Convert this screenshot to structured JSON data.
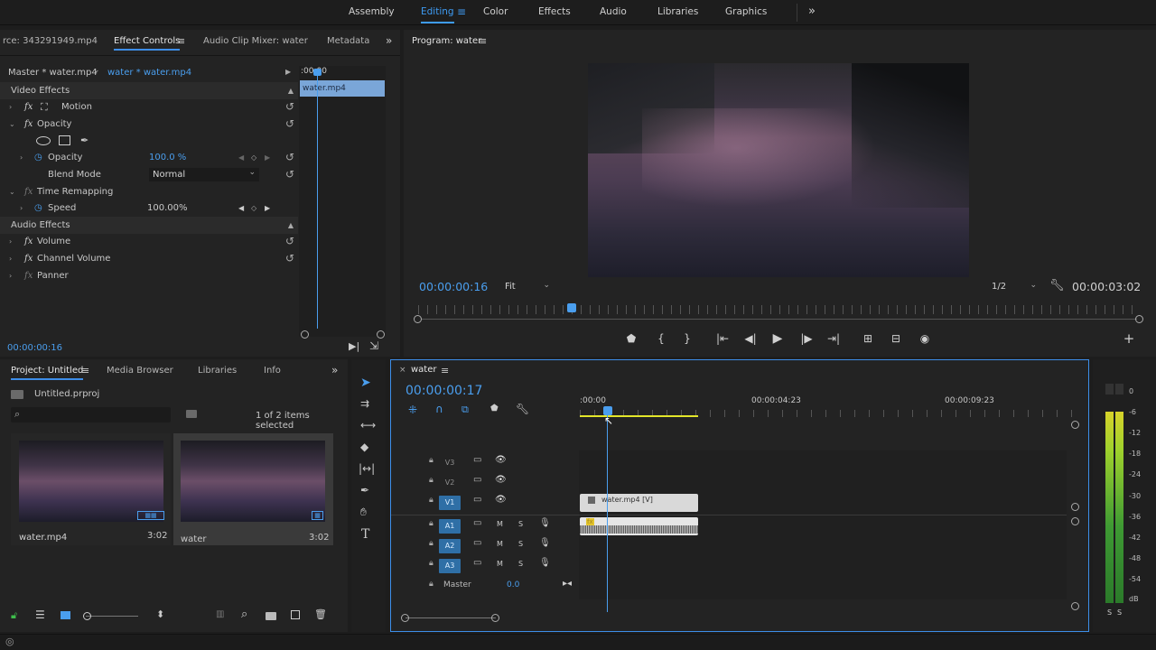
{
  "workspaces": {
    "tabs": [
      "Assembly",
      "Editing",
      "Color",
      "Effects",
      "Audio",
      "Libraries",
      "Graphics"
    ],
    "active": "Editing",
    "more": "»"
  },
  "source_panel": {
    "tabs": [
      "rce: 343291949.mp4",
      "Effect Controls",
      "Audio Clip Mixer: water",
      "Metadata"
    ],
    "active_tab": "Effect Controls",
    "master_label": "Master * water.mp4",
    "clip_label": "water * water.mp4",
    "mini_timecode": ":00:00",
    "mini_clip": "water.mp4",
    "video_effects_label": "Video Effects",
    "motion": "Motion",
    "opacity_group": "Opacity",
    "opacity_param": "Opacity",
    "opacity_value": "100.0 %",
    "blend_mode_label": "Blend Mode",
    "blend_mode_value": "Normal",
    "time_remapping": "Time Remapping",
    "speed_param": "Speed",
    "speed_value": "100.00%",
    "audio_effects_label": "Audio Effects",
    "volume": "Volume",
    "channel_volume": "Channel Volume",
    "panner": "Panner",
    "timecode": "00:00:00:16"
  },
  "program": {
    "title": "Program: water",
    "timecode": "00:00:00:16",
    "fit": "Fit",
    "resolution": "1/2",
    "duration": "00:00:03:02"
  },
  "project": {
    "tabs": [
      "Project: Untitled",
      "Media Browser",
      "Libraries",
      "Info"
    ],
    "active_tab": "Project: Untitled",
    "file": "Untitled.prproj",
    "search_placeholder": "",
    "selection_info": "1 of 2 items selected",
    "items": [
      {
        "name": "water.mp4",
        "duration": "3:02"
      },
      {
        "name": "water",
        "duration": "3:02"
      }
    ]
  },
  "timeline": {
    "sequence": "water",
    "timecode": "00:00:00:17",
    "ruler": [
      ":00:00",
      "00:00:04:23",
      "00:00:09:23"
    ],
    "video_tracks": [
      "V3",
      "V2",
      "V1"
    ],
    "audio_tracks": [
      "A1",
      "A2",
      "A3"
    ],
    "mute": "M",
    "solo": "S",
    "master_label": "Master",
    "master_value": "0.0",
    "video_clip": "water.mp4 [V]",
    "audio_clip_badge": "fx"
  },
  "meter": {
    "ticks": [
      "0",
      "-6",
      "-12",
      "-18",
      "-24",
      "-30",
      "-36",
      "-42",
      "-48",
      "-54",
      "dB"
    ],
    "solo_labels": [
      "S",
      "S"
    ]
  }
}
